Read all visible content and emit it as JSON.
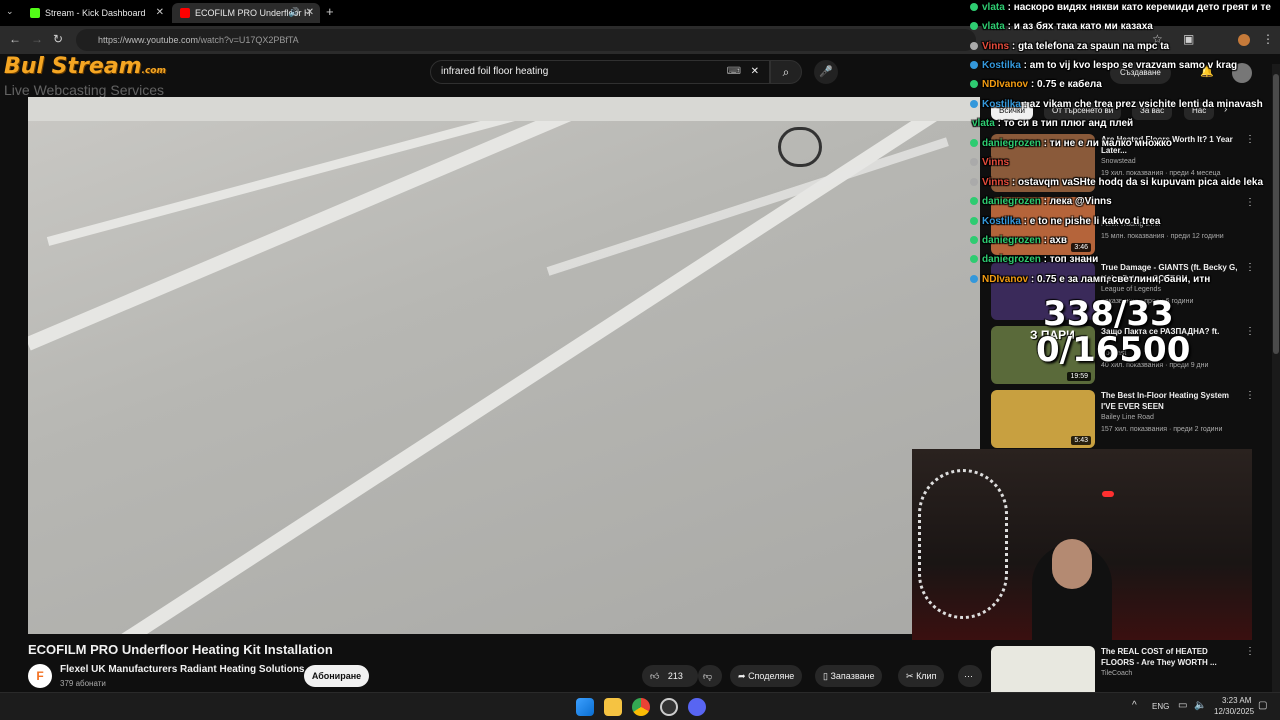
{
  "browser": {
    "tabs": [
      {
        "label": "Stream - Kick Dashboard",
        "favicon_color": "#53fc18"
      },
      {
        "label": "ECOFILM PRO Underfloor H",
        "favicon_color": "#ff0000"
      }
    ],
    "url_host": "https://www.youtube.com",
    "url_path": "/watch?v=U17QX2PBfTA"
  },
  "youtube": {
    "search_query": "infrared foil floor heating",
    "video_title": "ECOFILM PRO Underfloor Heating Kit Installation",
    "channel_name": "Flexel UK Manufacturers Radiant Heating Solutions",
    "channel_avatar_letter": "F",
    "subscribers": "379 абонати",
    "subscribe_label": "Абониране",
    "likes": "213",
    "share_label": "Споделяне",
    "save_label": "Запазване",
    "clip_label": "Клип",
    "create_label": "Създаване",
    "chips": [
      "Всички",
      "От търсенето ви",
      "За вас",
      "Нас"
    ],
    "recommendations": [
      {
        "title": "Are Heated Floors Worth It? 1 Year Later...",
        "channel": "Snowstead",
        "meta": "19 хил. показвания · преди 4 месеца",
        "duration": "",
        "thumb_color": "#8a5a3a"
      },
      {
        "title": "",
        "channel": "Fenix Trading s.r.o.",
        "meta": "15 млн. показвания · преди 12 години",
        "duration": "3:46",
        "thumb_color": "#b5643a"
      },
      {
        "title": "True Damage - GIANTS (ft. Becky G, Keke Palmer, SOYEON",
        "channel": "League of Legends",
        "meta": "показвания · преди 6 години",
        "duration": "",
        "thumb_color": "#3a2a5a"
      },
      {
        "title": "Защо Пакта се РАЗПАДНА? ft.",
        "channel": "Podcast",
        "meta": "40 хил. показвания · преди 9 дни",
        "duration": "19:59",
        "thumb_color": "#5a6a3a"
      },
      {
        "title": "The Best In-Floor Heating System I'VE EVER SEEN",
        "channel": "Bailey Line Road",
        "meta": "157 хил. показвания · преди 2 години",
        "duration": "5:43",
        "thumb_color": "#c8a040"
      },
      {
        "title": "The REAL COST of HEATED FLOORS - Are They WORTH ...",
        "channel": "TileCoach",
        "meta": "",
        "duration": "",
        "thumb_color": "#e8e8e0"
      }
    ]
  },
  "overlay": {
    "brand": "Bul Stream",
    "brand_suffix": ".com",
    "brand_sub": "Live Webcasting Services",
    "counter_top": "338/33",
    "counter_bottom": "0/16500",
    "counter_prefix": "З ПАРИ"
  },
  "chat": [
    {
      "user": "vlata",
      "color": "#2ecc71",
      "text": "наскоро видях някви като керемиди дето греят и те"
    },
    {
      "user": "vlata",
      "color": "#2ecc71",
      "text": "и аз бях така като ми казаха"
    },
    {
      "user": "Vinns",
      "color": "#e74c3c",
      "text": "gta telefona za spaun na mpc ta"
    },
    {
      "user": "Kostilka",
      "color": "#3498db",
      "text": "am to vij kvo lespo se vrazvam samo v krag"
    },
    {
      "user": "NDIvanov",
      "color": "#f39c12",
      "text": "0.75 е кабела"
    },
    {
      "user": "Kostilka",
      "color": "#3498db",
      "text": "az vikam che trea prez vsichite lenti da minavash"
    },
    {
      "user": "vlata",
      "color": "#2ecc71",
      "text": "то си в тип плюг анд плей"
    },
    {
      "user": "daniegrozen",
      "color": "#2ecc71",
      "text": "ти не е ли малко множко"
    },
    {
      "user": "Vinns",
      "color": "#e74c3c",
      "text": ""
    },
    {
      "user": "Vinns",
      "color": "#e74c3c",
      "text": "ostavqm vaSHte hodq da si kupuvam pica aide leka"
    },
    {
      "user": "daniegrozen",
      "color": "#2ecc71",
      "text": "лека @Vinns"
    },
    {
      "user": "Kostilka",
      "color": "#3498db",
      "text": "e to ne pishe li kakvo ti trea"
    },
    {
      "user": "daniegrozen",
      "color": "#2ecc71",
      "text": "ахв"
    },
    {
      "user": "daniegrozen",
      "color": "#2ecc71",
      "text": "топ знани"
    },
    {
      "user": "NDIvanov",
      "color": "#f39c12",
      "text": "0.75 е за ламп, светлини, бани, итн"
    }
  ],
  "taskbar": {
    "lang": "ENG",
    "time": "3:23 AM",
    "date": "12/30/2025"
  }
}
